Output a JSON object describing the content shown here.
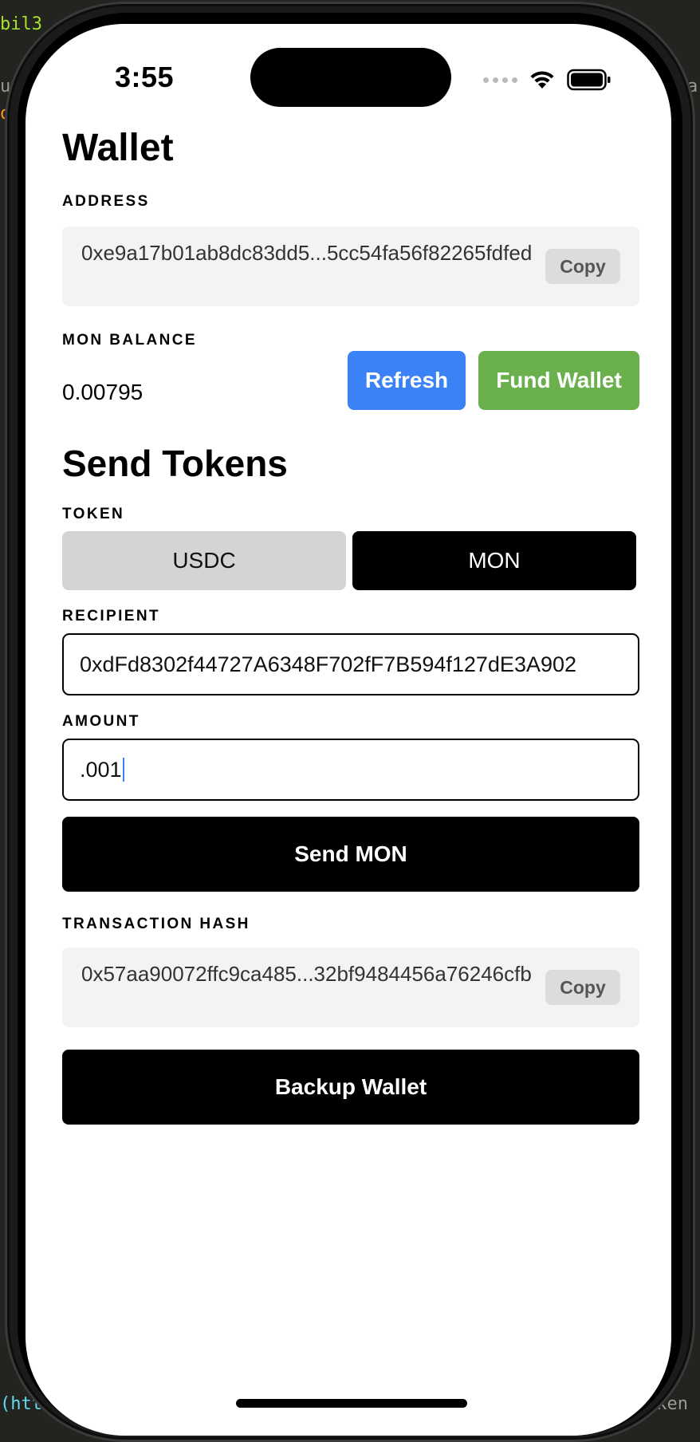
{
  "backdrop": {
    "fragments": [
      "bil3",
      "u",
      "o",
      "a",
      "(htt",
      "oken"
    ]
  },
  "status_bar": {
    "time": "3:55"
  },
  "wallet": {
    "title": "Wallet",
    "address_label": "ADDRESS",
    "address_value": "0xe9a17b01ab8dc83dd5...5cc54fa56f82265fdfed",
    "address_copy_label": "Copy",
    "balance_label": "MON BALANCE",
    "balance_value": "0.00795",
    "refresh_label": "Refresh",
    "fund_label": "Fund Wallet"
  },
  "send": {
    "title": "Send Tokens",
    "token_label": "TOKEN",
    "tokens": [
      "USDC",
      "MON"
    ],
    "selected_token": "MON",
    "recipient_label": "RECIPIENT",
    "recipient_value": "0xdFd8302f44727A6348F702fF7B594f127dE3A902",
    "amount_label": "AMOUNT",
    "amount_value": ".001",
    "send_button_label": "Send MON",
    "tx_hash_label": "TRANSACTION HASH",
    "tx_hash_value": "0x57aa90072ffc9ca485...32bf9484456a76246cfb",
    "tx_copy_label": "Copy",
    "backup_label": "Backup Wallet"
  },
  "colors": {
    "refresh": "#3b82f6",
    "fund": "#6ab04c",
    "primary": "#000000"
  }
}
